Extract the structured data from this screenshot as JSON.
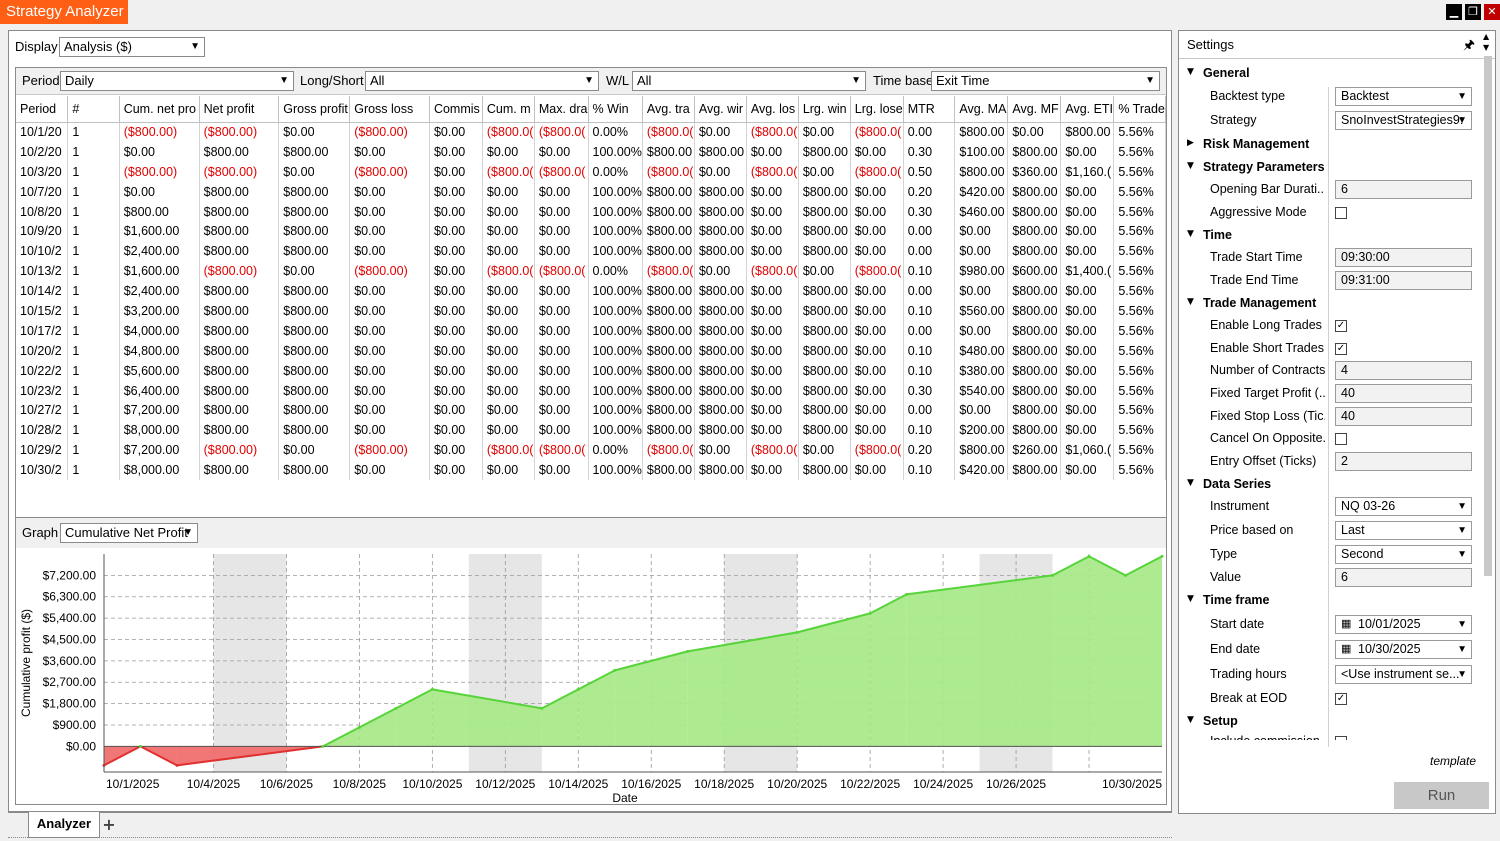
{
  "window": {
    "title": "Strategy Analyzer",
    "controls": [
      "minimize",
      "restore",
      "close"
    ]
  },
  "display": {
    "label": "Display",
    "value": "Analysis ($)"
  },
  "filters": {
    "period_label": "Period",
    "period_value": "Daily",
    "longshort_label": "Long/Short",
    "longshort_value": "All",
    "wl_label": "W/L",
    "wl_value": "All",
    "timebase_label": "Time base",
    "timebase_value": "Exit Time"
  },
  "table": {
    "columns": [
      "Period",
      "#",
      "Cum. net pro",
      "Net profit",
      "Gross profit",
      "Gross loss",
      "Commis",
      "Cum. m",
      "Max. dra",
      "% Win",
      "Avg. tra",
      "Avg. wir",
      "Avg. los",
      "Lrg. win",
      "Lrg. lose",
      "MTR",
      "Avg. MA",
      "Avg. MF",
      "Avg. ETI",
      "% Trade"
    ],
    "rows": [
      [
        "10/1/20",
        "1",
        "($800.00)",
        "($800.00)",
        "$0.00",
        "($800.00)",
        "$0.00",
        "($800.0(",
        "($800.0(",
        "0.00%",
        "($800.0(",
        "$0.00",
        "($800.0(",
        "$0.00",
        "($800.0(",
        "0.00",
        "$800.00",
        "$0.00",
        "$800.00",
        "5.56%"
      ],
      [
        "10/2/20",
        "1",
        "$0.00",
        "$800.00",
        "$800.00",
        "$0.00",
        "$0.00",
        "$0.00",
        "$0.00",
        "100.00%",
        "$800.00",
        "$800.00",
        "$0.00",
        "$800.00",
        "$0.00",
        "0.30",
        "$100.00",
        "$800.00",
        "$0.00",
        "5.56%"
      ],
      [
        "10/3/20",
        "1",
        "($800.00)",
        "($800.00)",
        "$0.00",
        "($800.00)",
        "$0.00",
        "($800.0(",
        "($800.0(",
        "0.00%",
        "($800.0(",
        "$0.00",
        "($800.0(",
        "$0.00",
        "($800.0(",
        "0.50",
        "$800.00",
        "$360.00",
        "$1,160.(",
        "5.56%"
      ],
      [
        "10/7/20",
        "1",
        "$0.00",
        "$800.00",
        "$800.00",
        "$0.00",
        "$0.00",
        "$0.00",
        "$0.00",
        "100.00%",
        "$800.00",
        "$800.00",
        "$0.00",
        "$800.00",
        "$0.00",
        "0.20",
        "$420.00",
        "$800.00",
        "$0.00",
        "5.56%"
      ],
      [
        "10/8/20",
        "1",
        "$800.00",
        "$800.00",
        "$800.00",
        "$0.00",
        "$0.00",
        "$0.00",
        "$0.00",
        "100.00%",
        "$800.00",
        "$800.00",
        "$0.00",
        "$800.00",
        "$0.00",
        "0.30",
        "$460.00",
        "$800.00",
        "$0.00",
        "5.56%"
      ],
      [
        "10/9/20",
        "1",
        "$1,600.00",
        "$800.00",
        "$800.00",
        "$0.00",
        "$0.00",
        "$0.00",
        "$0.00",
        "100.00%",
        "$800.00",
        "$800.00",
        "$0.00",
        "$800.00",
        "$0.00",
        "0.00",
        "$0.00",
        "$800.00",
        "$0.00",
        "5.56%"
      ],
      [
        "10/10/2",
        "1",
        "$2,400.00",
        "$800.00",
        "$800.00",
        "$0.00",
        "$0.00",
        "$0.00",
        "$0.00",
        "100.00%",
        "$800.00",
        "$800.00",
        "$0.00",
        "$800.00",
        "$0.00",
        "0.00",
        "$0.00",
        "$800.00",
        "$0.00",
        "5.56%"
      ],
      [
        "10/13/2",
        "1",
        "$1,600.00",
        "($800.00)",
        "$0.00",
        "($800.00)",
        "$0.00",
        "($800.0(",
        "($800.0(",
        "0.00%",
        "($800.0(",
        "$0.00",
        "($800.0(",
        "$0.00",
        "($800.0(",
        "0.10",
        "$980.00",
        "$600.00",
        "$1,400.(",
        "5.56%"
      ],
      [
        "10/14/2",
        "1",
        "$2,400.00",
        "$800.00",
        "$800.00",
        "$0.00",
        "$0.00",
        "$0.00",
        "$0.00",
        "100.00%",
        "$800.00",
        "$800.00",
        "$0.00",
        "$800.00",
        "$0.00",
        "0.00",
        "$0.00",
        "$800.00",
        "$0.00",
        "5.56%"
      ],
      [
        "10/15/2",
        "1",
        "$3,200.00",
        "$800.00",
        "$800.00",
        "$0.00",
        "$0.00",
        "$0.00",
        "$0.00",
        "100.00%",
        "$800.00",
        "$800.00",
        "$0.00",
        "$800.00",
        "$0.00",
        "0.10",
        "$560.00",
        "$800.00",
        "$0.00",
        "5.56%"
      ],
      [
        "10/17/2",
        "1",
        "$4,000.00",
        "$800.00",
        "$800.00",
        "$0.00",
        "$0.00",
        "$0.00",
        "$0.00",
        "100.00%",
        "$800.00",
        "$800.00",
        "$0.00",
        "$800.00",
        "$0.00",
        "0.00",
        "$0.00",
        "$800.00",
        "$0.00",
        "5.56%"
      ],
      [
        "10/20/2",
        "1",
        "$4,800.00",
        "$800.00",
        "$800.00",
        "$0.00",
        "$0.00",
        "$0.00",
        "$0.00",
        "100.00%",
        "$800.00",
        "$800.00",
        "$0.00",
        "$800.00",
        "$0.00",
        "0.10",
        "$480.00",
        "$800.00",
        "$0.00",
        "5.56%"
      ],
      [
        "10/22/2",
        "1",
        "$5,600.00",
        "$800.00",
        "$800.00",
        "$0.00",
        "$0.00",
        "$0.00",
        "$0.00",
        "100.00%",
        "$800.00",
        "$800.00",
        "$0.00",
        "$800.00",
        "$0.00",
        "0.10",
        "$380.00",
        "$800.00",
        "$0.00",
        "5.56%"
      ],
      [
        "10/23/2",
        "1",
        "$6,400.00",
        "$800.00",
        "$800.00",
        "$0.00",
        "$0.00",
        "$0.00",
        "$0.00",
        "100.00%",
        "$800.00",
        "$800.00",
        "$0.00",
        "$800.00",
        "$0.00",
        "0.30",
        "$540.00",
        "$800.00",
        "$0.00",
        "5.56%"
      ],
      [
        "10/27/2",
        "1",
        "$7,200.00",
        "$800.00",
        "$800.00",
        "$0.00",
        "$0.00",
        "$0.00",
        "$0.00",
        "100.00%",
        "$800.00",
        "$800.00",
        "$0.00",
        "$800.00",
        "$0.00",
        "0.00",
        "$0.00",
        "$800.00",
        "$0.00",
        "5.56%"
      ],
      [
        "10/28/2",
        "1",
        "$8,000.00",
        "$800.00",
        "$800.00",
        "$0.00",
        "$0.00",
        "$0.00",
        "$0.00",
        "100.00%",
        "$800.00",
        "$800.00",
        "$0.00",
        "$800.00",
        "$0.00",
        "0.10",
        "$200.00",
        "$800.00",
        "$0.00",
        "5.56%"
      ],
      [
        "10/29/2",
        "1",
        "$7,200.00",
        "($800.00)",
        "$0.00",
        "($800.00)",
        "$0.00",
        "($800.0(",
        "($800.0(",
        "0.00%",
        "($800.0(",
        "$0.00",
        "($800.0(",
        "$0.00",
        "($800.0(",
        "0.20",
        "$800.00",
        "$260.00",
        "$1,060.(",
        "5.56%"
      ],
      [
        "10/30/2",
        "1",
        "$8,000.00",
        "$800.00",
        "$800.00",
        "$0.00",
        "$0.00",
        "$0.00",
        "$0.00",
        "100.00%",
        "$800.00",
        "$800.00",
        "$0.00",
        "$800.00",
        "$0.00",
        "0.10",
        "$420.00",
        "$800.00",
        "$0.00",
        "5.56%"
      ]
    ]
  },
  "graph": {
    "label": "Graph",
    "value": "Cumulative Net Profit"
  },
  "chart_data": {
    "type": "area",
    "xlabel": "Date",
    "ylabel": "Cumulative profit ($)",
    "ylim": [
      -1080,
      8100
    ],
    "y_ticks": [
      "$7,200.00",
      "$6,300.00",
      "$5,400.00",
      "$4,500.00",
      "$3,600.00",
      "$2,700.00",
      "$1,800.00",
      "$900.00",
      "$0.00"
    ],
    "x_ticks": [
      "10/1/2025",
      "10/4/2025",
      "10/6/2025",
      "10/8/2025",
      "10/10/2025",
      "10/12/2025",
      "10/14/2025",
      "10/16/2025",
      "10/18/2025",
      "10/20/2025",
      "10/22/2025",
      "10/24/2025",
      "10/26/2025",
      "10/30/2025"
    ],
    "x_dates": [
      "2025-10-01",
      "2025-10-02",
      "2025-10-03",
      "2025-10-07",
      "2025-10-08",
      "2025-10-09",
      "2025-10-10",
      "2025-10-13",
      "2025-10-14",
      "2025-10-15",
      "2025-10-17",
      "2025-10-20",
      "2025-10-22",
      "2025-10-23",
      "2025-10-27",
      "2025-10-28",
      "2025-10-29",
      "2025-10-30"
    ],
    "values": [
      -800,
      0,
      -800,
      0,
      800,
      1600,
      2400,
      1600,
      2400,
      3200,
      4000,
      4800,
      5600,
      6400,
      7200,
      8000,
      7200,
      8000
    ],
    "colors": {
      "positive_fill": "#a9e98a",
      "positive_line": "#57d43a",
      "negative_fill": "#f07070",
      "negative_line": "#e03030"
    },
    "grid": true
  },
  "tabs": {
    "analyzer_label": "Analyzer",
    "add_label": "+"
  },
  "settings": {
    "title": "Settings",
    "categories": {
      "general": "General",
      "risk": "Risk Management",
      "params": "Strategy Parameters",
      "time": "Time",
      "trade_mgmt": "Trade Management",
      "data_series": "Data Series",
      "time_frame": "Time frame",
      "setup": "Setup"
    },
    "props": {
      "backtest_type": {
        "label": "Backtest type",
        "value": "Backtest"
      },
      "strategy": {
        "label": "Strategy",
        "value": "SnoInvestStrategies9:"
      },
      "opening_bar": {
        "label": "Opening Bar Durati...",
        "value": "6"
      },
      "aggressive": {
        "label": "Aggressive Mode",
        "checked": false
      },
      "trade_start": {
        "label": "Trade Start Time",
        "value": "09:30:00"
      },
      "trade_end": {
        "label": "Trade End Time",
        "value": "09:31:00"
      },
      "enable_long": {
        "label": "Enable Long Trades",
        "checked": true
      },
      "enable_short": {
        "label": "Enable Short Trades",
        "checked": true
      },
      "contracts": {
        "label": "Number of Contracts",
        "value": "4"
      },
      "target_profit": {
        "label": "Fixed Target Profit (...",
        "value": "40"
      },
      "stop_loss": {
        "label": "Fixed Stop Loss (Tic...",
        "value": "40"
      },
      "cancel_opposite": {
        "label": "Cancel On Opposite...",
        "checked": false
      },
      "entry_offset": {
        "label": "Entry Offset (Ticks)",
        "value": "2"
      },
      "instrument": {
        "label": "Instrument",
        "value": "NQ 03-26"
      },
      "price_based": {
        "label": "Price based on",
        "value": "Last"
      },
      "type": {
        "label": "Type",
        "value": "Second"
      },
      "value": {
        "label": "Value",
        "value": "6"
      },
      "start_date": {
        "label": "Start date",
        "value": "10/01/2025"
      },
      "end_date": {
        "label": "End date",
        "value": "10/30/2025"
      },
      "trading_hours": {
        "label": "Trading hours",
        "value": "<Use instrument se..."
      },
      "break_eod": {
        "label": "Break at EOD",
        "checked": true
      },
      "include_commission": {
        "label": "Include commission",
        "checked": false
      }
    },
    "template_label": "template",
    "run_label": "Run"
  }
}
